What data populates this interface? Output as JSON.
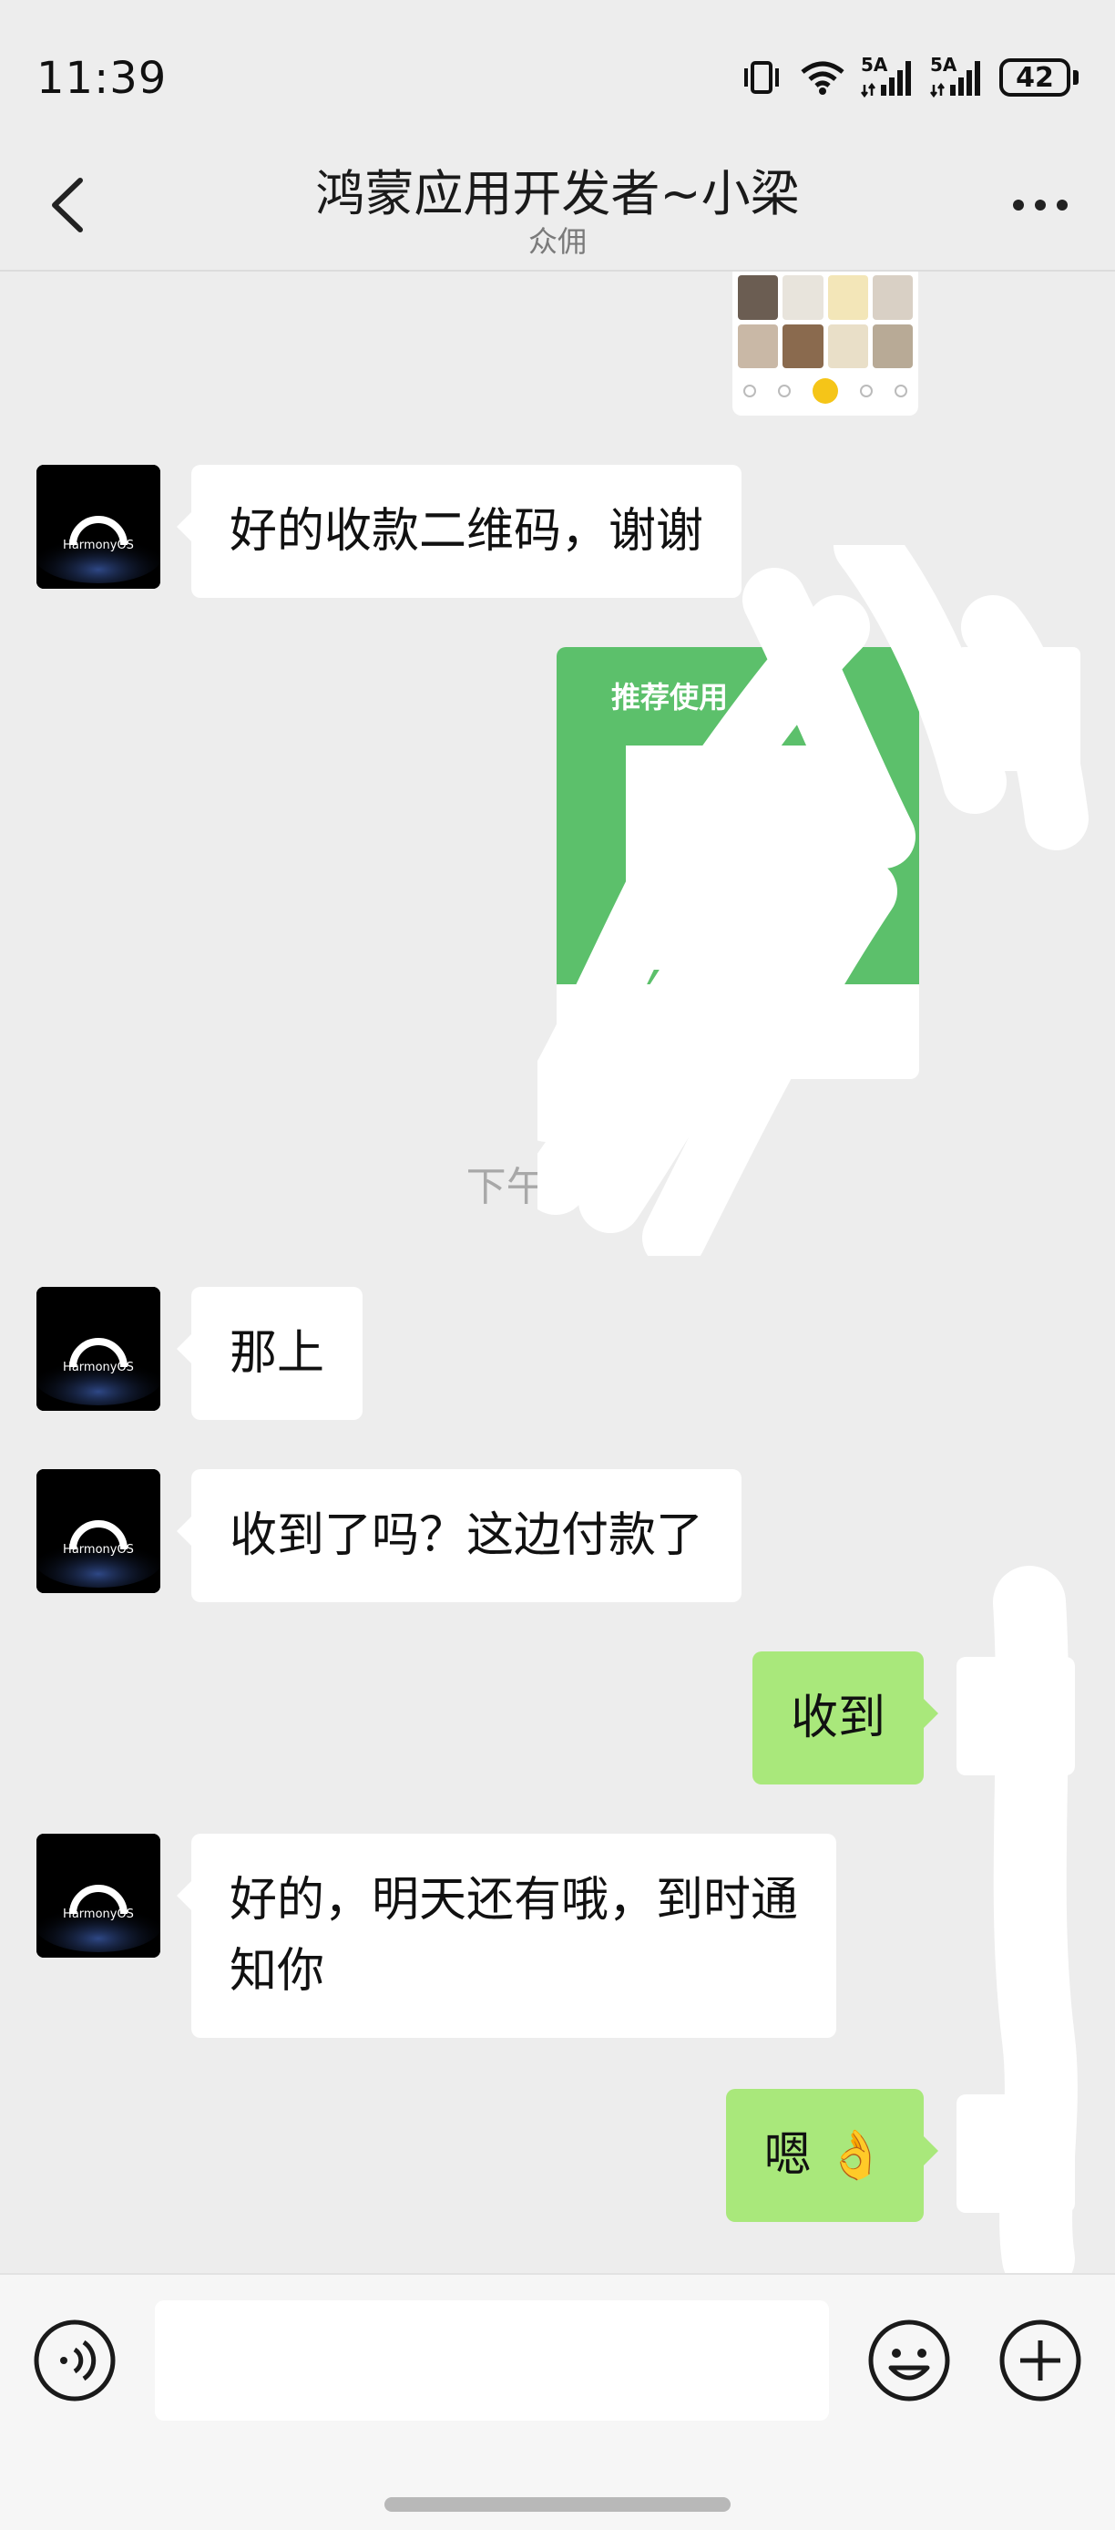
{
  "status_bar": {
    "time": "11:39",
    "network_label_1": "5A",
    "network_label_2": "5A",
    "battery": "42",
    "icons": [
      "vibrate-icon",
      "wifi-icon",
      "signal-icon",
      "signal-icon",
      "battery-icon"
    ]
  },
  "header": {
    "title": "鸿蒙应用开发者~小梁",
    "subtitle": "众佣",
    "back_icon": "chevron-left-icon",
    "more_icon": "more-dots-icon"
  },
  "messages": [
    {
      "side": "outgoing",
      "type": "image",
      "note": "app screenshot thumbnail"
    },
    {
      "side": "incoming",
      "type": "text",
      "text": "好的收款二维码，谢谢",
      "avatar_text": "HarmonyOS"
    },
    {
      "side": "outgoing",
      "type": "qr-card",
      "card_text": "推荐使用"
    },
    {
      "type": "timestamp",
      "text": "下午 11:3"
    },
    {
      "side": "incoming",
      "type": "text",
      "text": "那上",
      "avatar_text": "HarmonyOS"
    },
    {
      "side": "incoming",
      "type": "text",
      "text": "收到了吗？这边付款了",
      "avatar_text": "HarmonyOS"
    },
    {
      "side": "outgoing",
      "type": "text",
      "text": "收到"
    },
    {
      "side": "incoming",
      "type": "text",
      "text_line1": "好的，明天还有哦，到时通",
      "text_line2": "知你",
      "avatar_text": "HarmonyOS"
    },
    {
      "side": "outgoing",
      "type": "text",
      "text": "嗯 👌"
    }
  ],
  "input_bar": {
    "voice_icon": "voice-icon",
    "input_value": "",
    "emoji_icon": "emoji-icon",
    "plus_icon": "plus-icon"
  },
  "colors": {
    "background": "#ededed",
    "outgoing_bubble": "#a9e87b",
    "incoming_bubble": "#ffffff",
    "qr_green": "#5cc06b"
  }
}
